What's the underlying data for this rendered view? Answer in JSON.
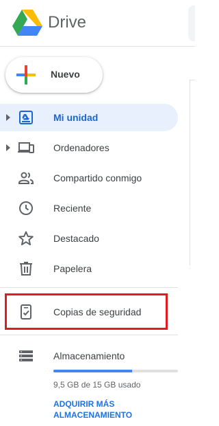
{
  "app": {
    "brand": "Drive"
  },
  "new_button": {
    "label": "Nuevo"
  },
  "nav": {
    "items": [
      {
        "label": "Mi unidad",
        "icon": "my-drive-icon",
        "active": true,
        "expandable": true
      },
      {
        "label": "Ordenadores",
        "icon": "computers-icon",
        "active": false,
        "expandable": true
      },
      {
        "label": "Compartido conmigo",
        "icon": "shared-people-icon",
        "active": false,
        "expandable": false
      },
      {
        "label": "Reciente",
        "icon": "clock-icon",
        "active": false,
        "expandable": false
      },
      {
        "label": "Destacado",
        "icon": "star-icon",
        "active": false,
        "expandable": false
      },
      {
        "label": "Papelera",
        "icon": "trash-icon",
        "active": false,
        "expandable": false
      }
    ],
    "backups": {
      "label": "Copias de seguridad",
      "icon": "backup-device-icon",
      "highlighted": true
    }
  },
  "storage": {
    "title": "Almacenamiento",
    "usage": "9,5 GB de 15 GB usado",
    "used_fraction": 0.63,
    "cta_line1": "ADQUIRIR MÁS",
    "cta_line2": "ALMACENAMIENTO"
  },
  "colors": {
    "accent": "#1967d2",
    "active_bg": "#e8f0fe",
    "highlight": "#e11b22",
    "storage_fill": "#4285f4"
  }
}
